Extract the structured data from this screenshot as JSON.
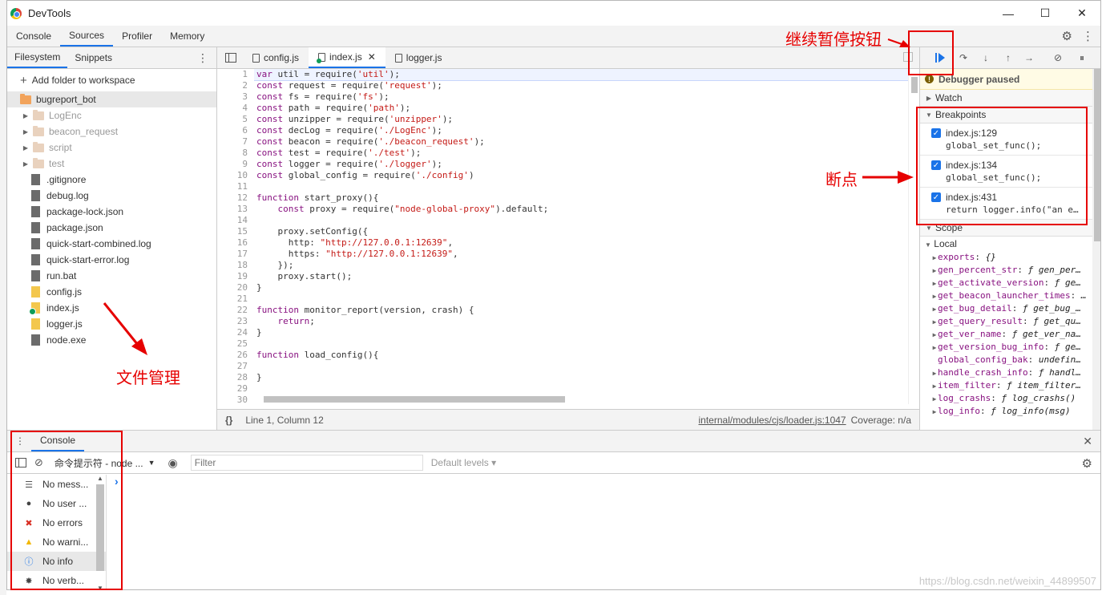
{
  "window": {
    "title": "DevTools",
    "minimize_icon": "minimize-icon",
    "maximize_icon": "maximize-icon",
    "close_icon": "close-icon"
  },
  "main_tabs": [
    {
      "label": "Console"
    },
    {
      "label": "Sources"
    },
    {
      "label": "Profiler"
    },
    {
      "label": "Memory"
    }
  ],
  "navigator": {
    "tabs": [
      {
        "label": "Filesystem"
      },
      {
        "label": "Snippets"
      }
    ],
    "add_folder": "Add folder to workspace",
    "root": "bugreport_bot",
    "folders": [
      {
        "label": "LogEnc"
      },
      {
        "label": "beacon_request"
      },
      {
        "label": "script"
      },
      {
        "label": "test"
      }
    ],
    "files": [
      {
        "label": ".gitignore",
        "type": "doc"
      },
      {
        "label": "debug.log",
        "type": "doc"
      },
      {
        "label": "package-lock.json",
        "type": "doc"
      },
      {
        "label": "package.json",
        "type": "doc"
      },
      {
        "label": "quick-start-combined.log",
        "type": "doc"
      },
      {
        "label": "quick-start-error.log",
        "type": "doc"
      },
      {
        "label": "run.bat",
        "type": "doc"
      },
      {
        "label": "config.js",
        "type": "js"
      },
      {
        "label": "index.js",
        "type": "js"
      },
      {
        "label": "logger.js",
        "type": "js"
      },
      {
        "label": "node.exe",
        "type": "doc"
      }
    ]
  },
  "editor": {
    "tabs": [
      {
        "label": "config.js"
      },
      {
        "label": "index.js"
      },
      {
        "label": "logger.js"
      }
    ],
    "code_lines": [
      "var util = require('util');",
      "const request = require('request');",
      "const fs = require('fs');",
      "const path = require('path');",
      "const unzipper = require('unzipper');",
      "const decLog = require('./LogEnc');",
      "const beacon = require('./beacon_request');",
      "const test = require('./test');",
      "const logger = require('./logger');",
      "const global_config = require('./config')",
      "",
      "function start_proxy(){",
      "    const proxy = require(\"node-global-proxy\").default;",
      "",
      "    proxy.setConfig({",
      "      http: \"http://127.0.0.1:12639\",",
      "      https: \"http://127.0.0.1:12639\",",
      "    });",
      "    proxy.start();",
      "}",
      "",
      "function monitor_report(version, crash) {",
      "    return;",
      "}",
      "",
      "function load_config(){",
      "",
      "}",
      "",
      ""
    ],
    "status_position": "Line 1, Column 12",
    "status_link": "internal/modules/cjs/loader.js:1047",
    "status_coverage": "Coverage: n/a",
    "format_label": "{}"
  },
  "debugger": {
    "paused_text": "Debugger paused",
    "sections": {
      "watch": "Watch",
      "breakpoints": "Breakpoints",
      "scope": "Scope",
      "local": "Local"
    },
    "breakpoints": [
      {
        "loc": "index.js:129",
        "code": "global_set_func();"
      },
      {
        "loc": "index.js:134",
        "code": "global_set_func();"
      },
      {
        "loc": "index.js:431",
        "code": "return logger.info(\"an e…"
      }
    ],
    "scope_items": [
      {
        "name": "exports",
        "value": "{}",
        "expandable": true
      },
      {
        "name": "gen_percent_str",
        "value": "ƒ gen_per…",
        "expandable": true
      },
      {
        "name": "get_activate_version",
        "value": "ƒ ge…",
        "expandable": true
      },
      {
        "name": "get_beacon_launcher_times",
        "value": "…",
        "expandable": true
      },
      {
        "name": "get_bug_detail",
        "value": "ƒ get_bug_…",
        "expandable": true
      },
      {
        "name": "get_query_result",
        "value": "ƒ get_qu…",
        "expandable": true
      },
      {
        "name": "get_ver_name",
        "value": "ƒ get_ver_na…",
        "expandable": true
      },
      {
        "name": "get_version_bug_info",
        "value": "ƒ ge…",
        "expandable": true
      },
      {
        "name": "global_config_bak",
        "value": "undefin…",
        "expandable": false
      },
      {
        "name": "handle_crash_info",
        "value": "ƒ handl…",
        "expandable": true
      },
      {
        "name": "item_filter",
        "value": "ƒ item_filter…",
        "expandable": true
      },
      {
        "name": "log_crashs",
        "value": "ƒ log_crashs()",
        "expandable": true
      },
      {
        "name": "log_info",
        "value": "ƒ log_info(msg)",
        "expandable": true
      }
    ]
  },
  "drawer": {
    "tab": "Console",
    "context": "命令提示符 - node ...",
    "filter_placeholder": "Filter",
    "levels": "Default levels ▾",
    "sidebar": [
      {
        "label": "No mess...",
        "icon": "list-icon"
      },
      {
        "label": "No user ...",
        "icon": "user-icon"
      },
      {
        "label": "No errors",
        "icon": "error-icon"
      },
      {
        "label": "No warni...",
        "icon": "warning-icon"
      },
      {
        "label": "No info",
        "icon": "info-icon"
      },
      {
        "label": "No verb...",
        "icon": "bug-icon"
      }
    ],
    "prompt": "›"
  },
  "annotations": {
    "pause_button": "继续暂停按钮",
    "breakpoints": "断点",
    "file_manager": "文件管理",
    "color": "#e60000"
  },
  "watermark": "https://blog.csdn.net/weixin_44899507"
}
